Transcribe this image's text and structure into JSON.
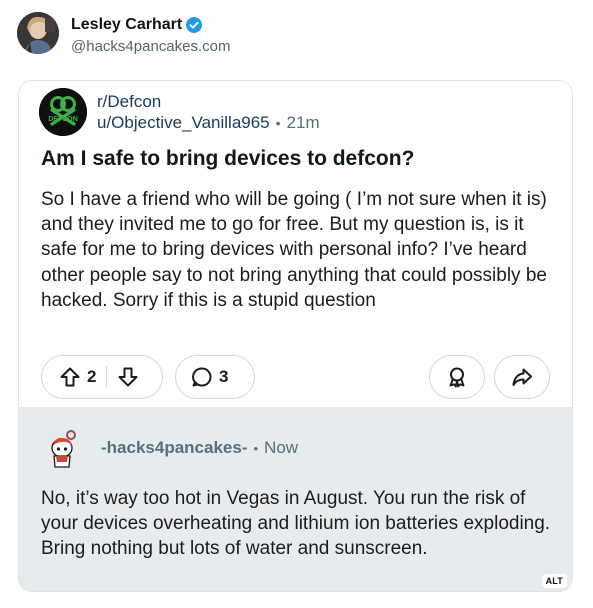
{
  "post": {
    "author_name": "Lesley Carhart",
    "author_handle": "@hacks4pancakes.com"
  },
  "reddit": {
    "subreddit": "r/Defcon",
    "sub_icon_text": "DEFCON",
    "username": "u/Objective_Vanilla965",
    "separator": "•",
    "time": "21m",
    "title": "Am I safe to bring devices to defcon?",
    "body": "So I have a friend who will be going ( I’m not sure when it is) and they invited me to go for free. But my question is, is it safe for me to bring devices with personal info? I’ve heard other people say to not bring anything that could possibly be hacked. Sorry if this is a stupid question",
    "upvotes": "2",
    "comments": "3"
  },
  "reply": {
    "username": "-hacks4pancakes-",
    "separator": "•",
    "time": "Now",
    "body": "No, it’s way too hot in Vegas in August. You run the risk of your devices overheating and lithium ion batteries exploding. Bring nothing but lots of water and sunscreen."
  },
  "image": {
    "alt_badge": "ALT"
  },
  "icons": {
    "verified": "verified-check-icon",
    "upvote": "arrow-up-icon",
    "downvote": "arrow-down-icon",
    "comment": "comment-bubble-icon",
    "award": "award-icon",
    "share": "share-arrow-icon"
  },
  "colors": {
    "verified_blue": "#1d9bf0",
    "link_navy": "#1a3a5e",
    "reply_bg": "#e8ebee",
    "muted": "#576f76"
  }
}
